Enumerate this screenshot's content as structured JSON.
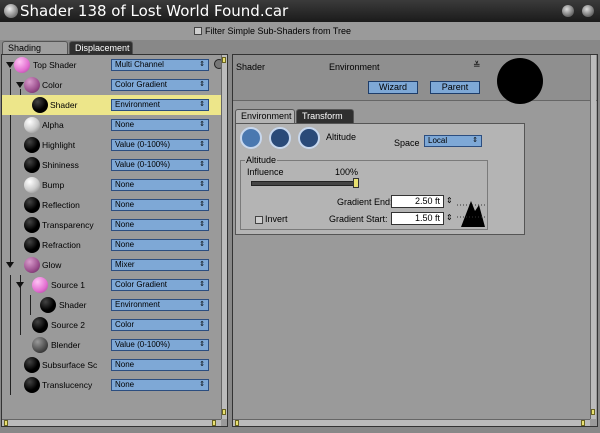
{
  "window": {
    "title": "Shader 138 of Lost World Found.car"
  },
  "filter": {
    "label": "Filter Simple Sub-Shaders from Tree"
  },
  "left_tabs": [
    {
      "label": "Shading"
    },
    {
      "label": "Displacement"
    }
  ],
  "tree": [
    {
      "label": "Top Shader",
      "value": "Multi Channel"
    },
    {
      "label": "Color",
      "value": "Color Gradient"
    },
    {
      "label": "Shader",
      "value": "Environment"
    },
    {
      "label": "Alpha",
      "value": "None"
    },
    {
      "label": "Highlight",
      "value": "Value (0-100%)"
    },
    {
      "label": "Shininess",
      "value": "Value (0-100%)"
    },
    {
      "label": "Bump",
      "value": "None"
    },
    {
      "label": "Reflection",
      "value": "None"
    },
    {
      "label": "Transparency",
      "value": "None"
    },
    {
      "label": "Refraction",
      "value": "None"
    },
    {
      "label": "Glow",
      "value": "Mixer"
    },
    {
      "label": "Source 1",
      "value": "Color Gradient"
    },
    {
      "label": "Shader",
      "value": "Environment"
    },
    {
      "label": "Source 2",
      "value": "Color"
    },
    {
      "label": "Blender",
      "value": "Value (0-100%)"
    },
    {
      "label": "Subsurface Sc",
      "value": "None"
    },
    {
      "label": "Translucency",
      "value": "None"
    }
  ],
  "shader_header": {
    "shader_label": "Shader",
    "shader_type": "Environment",
    "wizard_button": "Wizard",
    "parent_button": "Parent"
  },
  "inner_tabs": [
    {
      "label": "Environment"
    },
    {
      "label": "Transform"
    }
  ],
  "env": {
    "altitude_label": "Altitude",
    "space_label": "Space",
    "space_value": "Local",
    "group_title": "Altitude",
    "influence_label": "Influence",
    "influence_value": "100%",
    "influence_level": 1.0,
    "invert_label": "Invert",
    "gradient_end_label": "Gradient End:",
    "gradient_end_value": "2.50 ft",
    "gradient_start_label": "Gradient Start:",
    "gradient_start_value": "1.50 ft"
  },
  "colors": {
    "accent_blue": "#7ea8d6",
    "selection_yellow": "#ede68a",
    "panel_grey": "#9a9a9a"
  }
}
